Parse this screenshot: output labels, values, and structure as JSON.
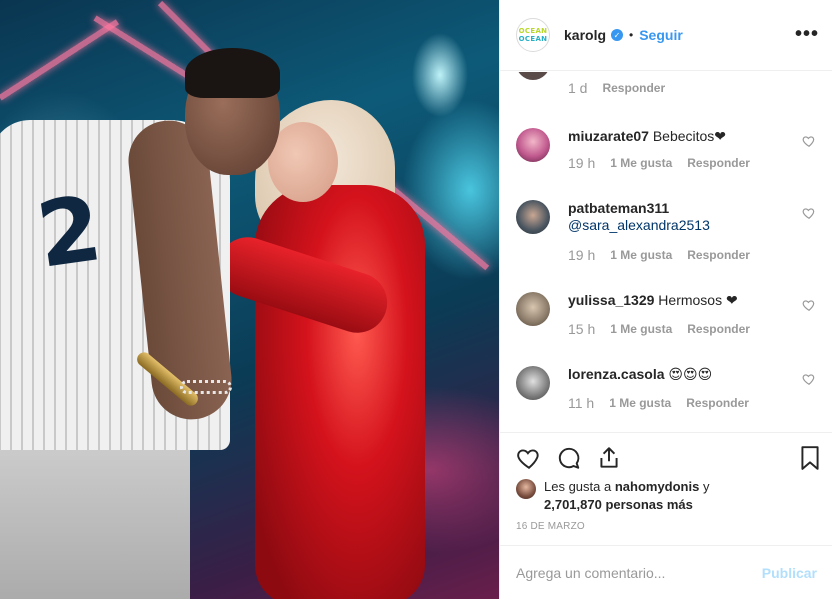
{
  "post": {
    "username": "karolg",
    "verified_icon": "verified-badge-icon",
    "separator": "•",
    "follow_label": "Seguir",
    "more_label": "•••",
    "logo_line1": "OCEAN",
    "logo_line2": "OCEAN"
  },
  "partial_comment": {
    "time": "1 d",
    "reply_label": "Responder"
  },
  "comments": [
    {
      "user": "miuzarate07",
      "text": " Bebecitos❤",
      "mention": "",
      "time": "19 h",
      "likes": "1 Me gusta",
      "reply": "Responder",
      "avatar_color": "#c15a8f"
    },
    {
      "user": "patbateman311",
      "text": "",
      "mention": "@sara_alexandra2513",
      "time": "19 h",
      "likes": "1 Me gusta",
      "reply": "Responder",
      "avatar_color": "#4a5560"
    },
    {
      "user": "yulissa_1329",
      "text": " Hermosos ❤",
      "mention": "",
      "time": "15 h",
      "likes": "1 Me gusta",
      "reply": "Responder",
      "avatar_color": "#8a7a68"
    },
    {
      "user": "lorenza.casola",
      "text": " 😍😍😍",
      "mention": "",
      "time": "11 h",
      "likes": "1 Me gusta",
      "reply": "Responder",
      "avatar_color": "#7a7a7a"
    }
  ],
  "likes_line": {
    "prefix": "Les gusta a ",
    "user": "nahomydonis",
    "middle": " y",
    "count": "2,701,870 personas más"
  },
  "date": "16 DE MARZO",
  "add_comment": {
    "placeholder": "Agrega un comentario...",
    "post_label": "Publicar"
  },
  "icons": {
    "like": "heart-outline-icon",
    "comment": "comment-bubble-icon",
    "share": "share-icon",
    "save": "bookmark-icon"
  }
}
